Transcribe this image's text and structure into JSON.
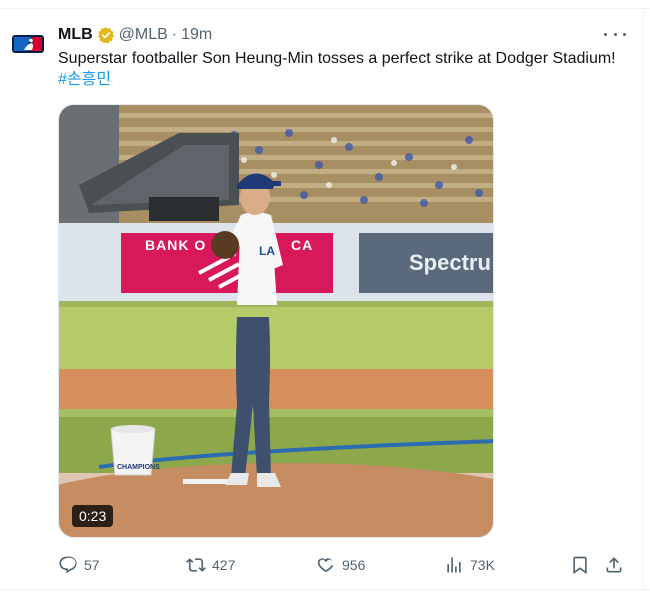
{
  "tweet": {
    "author_name": "MLB",
    "author_handle": "@MLB",
    "separator": "·",
    "time": "19m",
    "text": "Superstar footballer Son Heung-Min tosses a perfect strike at Dodger Stadium! ",
    "hashtag": "#손흥민"
  },
  "media": {
    "duration": "0:23",
    "banner_left": "BANK O",
    "banner_left_suffix": "CA",
    "banner_right": "Spectru",
    "bucket_label": "CHAMPIONS"
  },
  "actions": {
    "replies": "57",
    "reposts": "427",
    "likes": "956",
    "views": "73K"
  },
  "icons": {
    "avatar": "mlb-logo-icon",
    "verified": "gold-verified-badge-icon",
    "more": "more-options-icon",
    "reply": "reply-icon",
    "repost": "repost-icon",
    "like": "heart-icon",
    "views": "analytics-icon",
    "bookmark": "bookmark-icon",
    "share": "share-icon"
  },
  "colors": {
    "accent": "#1d9bf0",
    "text": "#0f1419",
    "secondary": "#536471",
    "verified_gold": "#e2b719"
  }
}
